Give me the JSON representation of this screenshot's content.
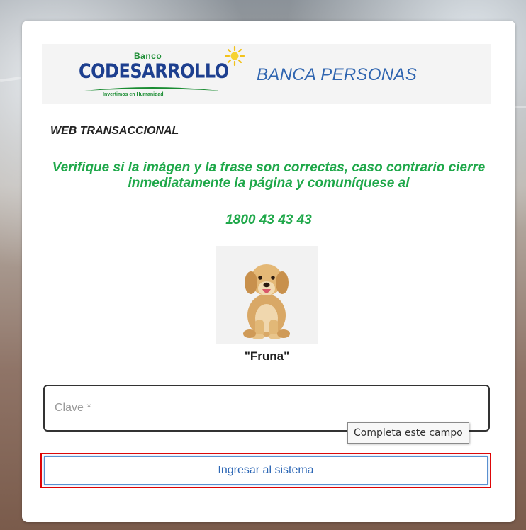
{
  "logo": {
    "top_word": "Banco",
    "name": "CODESARROLLO",
    "tagline": "Invertimos en Humanidad"
  },
  "header": {
    "banca_title": "BANCA PERSONAS",
    "web_title": "WEB TRANSACCIONAL"
  },
  "verification": {
    "message": "Verifique si la imágen y la frase son correctas, caso contrario cierre inmediatamente la página y comuníquese al",
    "phone": "1800 43 43 43",
    "security_phrase": "\"Fruna\"",
    "security_image_icon": "puppy-icon"
  },
  "form": {
    "password_placeholder": "Clave *",
    "password_value": "",
    "validation_tooltip": "Completa este campo",
    "submit_label": "Ingresar al sistema"
  },
  "colors": {
    "brand_blue": "#1d3f8f",
    "brand_green": "#1a8c32",
    "message_green": "#1fa84a",
    "link_blue": "#2f65b0",
    "highlight_red": "#e00000"
  }
}
